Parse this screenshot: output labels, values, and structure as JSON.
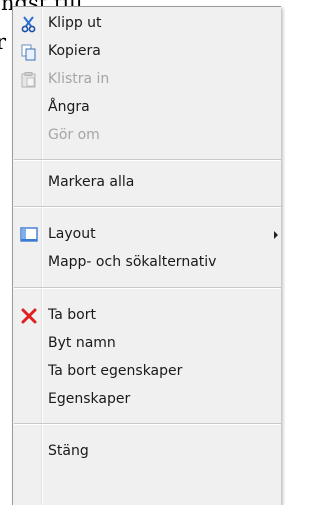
{
  "background": {
    "line1": "ngst till",
    "line2": "r"
  },
  "menu": {
    "items": [
      {
        "label": "Klipp ut",
        "icon": "scissors-icon",
        "enabled": true
      },
      {
        "label": "Kopiera",
        "icon": "copy-icon",
        "enabled": true
      },
      {
        "label": "Klistra in",
        "icon": "paste-icon",
        "enabled": false
      },
      {
        "label": "Ångra",
        "enabled": true
      },
      {
        "label": "Gör om",
        "enabled": false
      },
      {
        "label": "Markera alla",
        "enabled": true
      },
      {
        "label": "Layout",
        "icon": "layout-icon",
        "enabled": true,
        "submenu": true
      },
      {
        "label": "Mapp- och sökalternativ",
        "enabled": true
      },
      {
        "label": "Ta bort",
        "icon": "delete-icon",
        "enabled": true
      },
      {
        "label": "Byt namn",
        "enabled": true
      },
      {
        "label": "Ta bort egenskaper",
        "enabled": true
      },
      {
        "label": "Egenskaper",
        "enabled": true
      },
      {
        "label": "Stäng",
        "enabled": true
      }
    ]
  },
  "colors": {
    "menu_bg": "#f0f0f0",
    "disabled_text": "#a5a5a5",
    "delete_icon": "#e02020",
    "scissors_icon": "#2a6fd6"
  }
}
